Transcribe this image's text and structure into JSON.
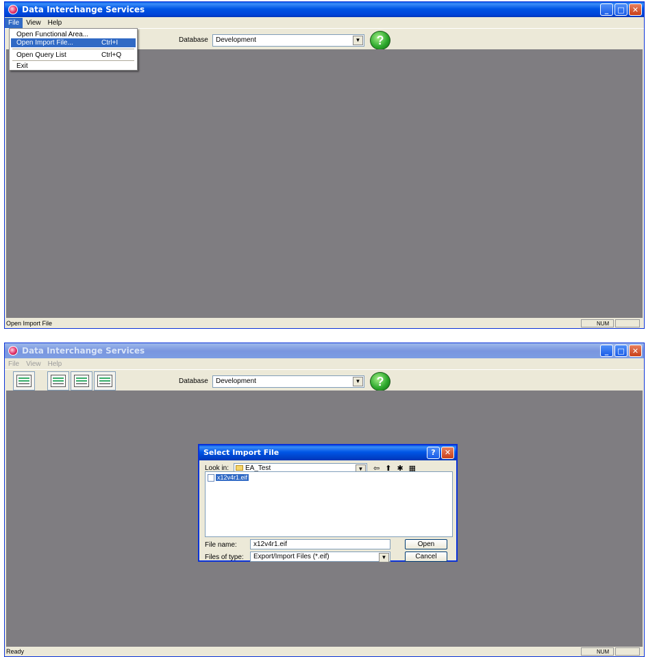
{
  "app": {
    "title": "Data Interchange Services"
  },
  "menu": {
    "file": "File",
    "view": "View",
    "help": "Help"
  },
  "file_menu": {
    "open_functional_area": "Open Functional Area...",
    "open_import_file": "Open Import File...",
    "open_import_file_shortcut": "Ctrl+I",
    "open_query_list": "Open Query List",
    "open_query_list_shortcut": "Ctrl+Q",
    "exit": "Exit"
  },
  "toolbar": {
    "database_label": "Database",
    "database_value": "Development",
    "help_glyph": "?"
  },
  "status1": {
    "text": "Open Import File",
    "num": "NUM"
  },
  "status2": {
    "text": "Ready",
    "num": "NUM"
  },
  "dialog": {
    "title": "Select Import File",
    "look_in_label": "Look in:",
    "look_in_value": "EA_Test",
    "file_item": "x12v4r1.eif",
    "file_name_label": "File name:",
    "file_name_value": "x12v4r1.eif",
    "file_type_label": "Files of type:",
    "file_type_value": "Export/Import Files (*.eif)",
    "open_button": "Open",
    "cancel_button": "Cancel"
  },
  "colors": {
    "titlebar": "#0055e5",
    "client": "#7f7d81",
    "highlight": "#316ac5",
    "face": "#ece9d8"
  },
  "icons": [
    "app-icon",
    "minimize-icon",
    "maximize-icon",
    "close-icon",
    "help-icon",
    "folder-icon",
    "back-arrow-icon",
    "up-folder-icon",
    "new-folder-icon",
    "view-menu-icon",
    "file-icon"
  ]
}
